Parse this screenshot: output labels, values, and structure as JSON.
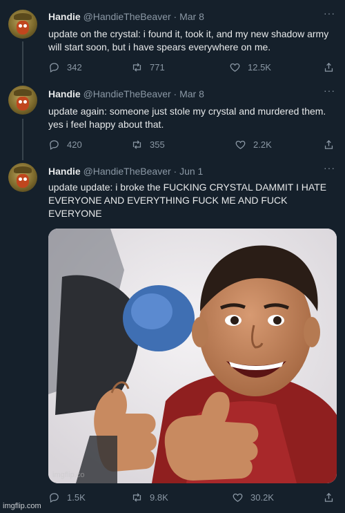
{
  "tweets": [
    {
      "name": "Handie",
      "handle": "@HandieTheBeaver",
      "date": "Mar 8",
      "text": "update on the crystal: i found it, took it, and my new shadow army will start soon, but i have spears everywhere on me.",
      "replies": "342",
      "retweets": "771",
      "likes": "12.5K"
    },
    {
      "name": "Handie",
      "handle": "@HandieTheBeaver",
      "date": "Mar 8",
      "text": "update again: someone just stole my crystal and murdered them. yes i feel happy about that.",
      "replies": "420",
      "retweets": "355",
      "likes": "2.2K"
    },
    {
      "name": "Handie",
      "handle": "@HandieTheBeaver",
      "date": "Jun 1",
      "text": "update update: i broke the FUCKING CRYSTAL DAMMIT I HATE EVERYONE AND EVERYTHING FUCK ME AND FUCK EVERYONE",
      "replies": "1.5K",
      "retweets": "9.8K",
      "likes": "30.2K"
    }
  ],
  "separator": "·",
  "more_glyph": "···",
  "watermark": "imgflip.com",
  "icons": [
    "reply-icon",
    "retweet-icon",
    "like-icon",
    "share-icon",
    "more-icon"
  ]
}
